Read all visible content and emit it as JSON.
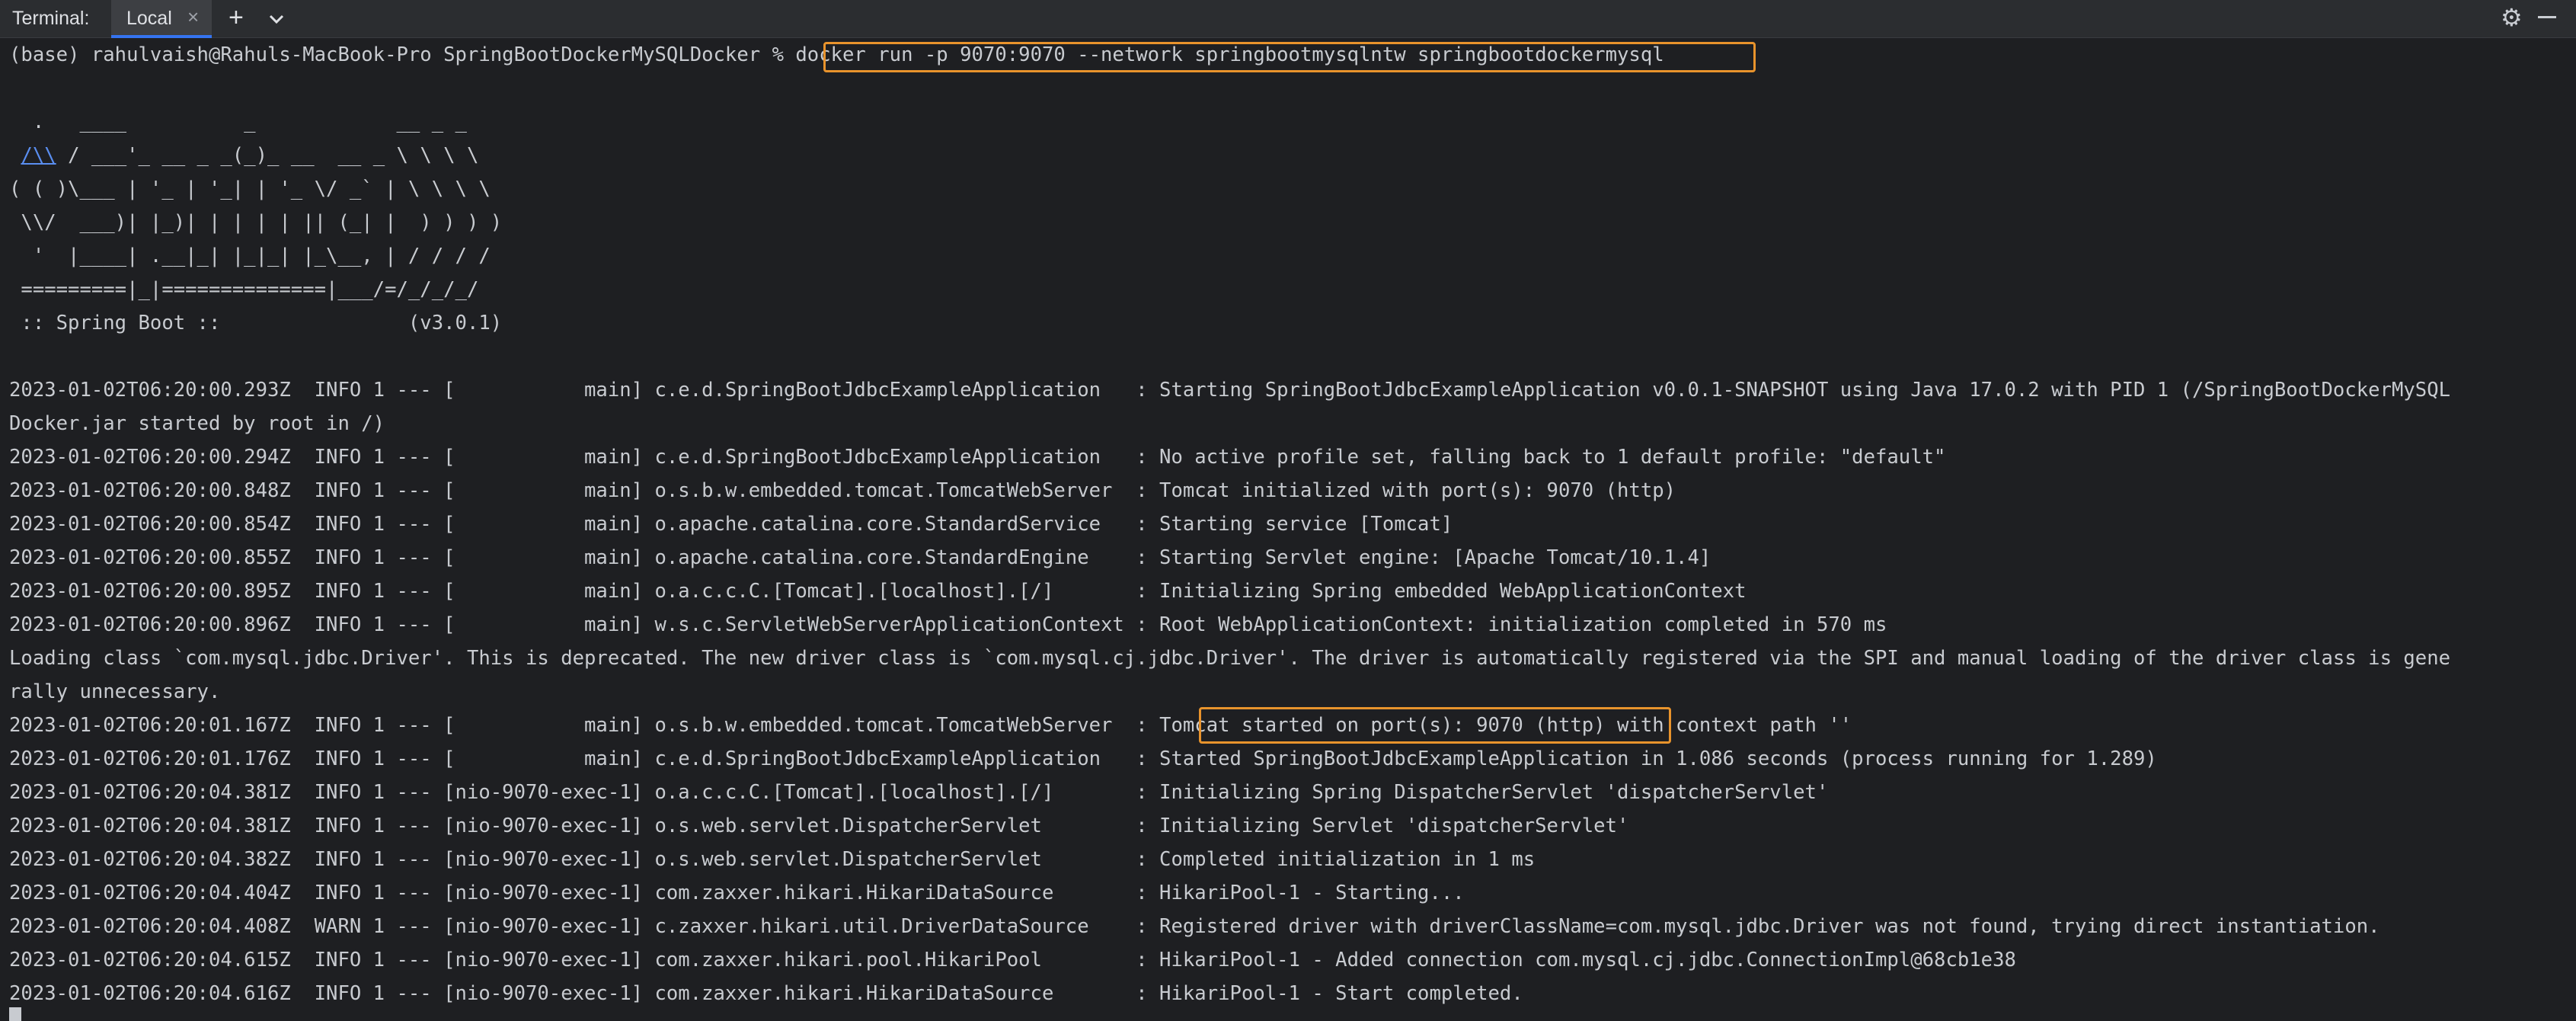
{
  "tabbar": {
    "title": "Terminal:",
    "tab_label": "Local",
    "close_glyph": "×",
    "add_glyph": "+",
    "icons": [
      "close-icon",
      "plus-icon",
      "chevron-down-icon",
      "gear-icon",
      "minimize-icon"
    ]
  },
  "accent": "#e8932c",
  "terminal": {
    "prompt": "(base) rahulvaish@Rahuls-MacBook-Pro SpringBootDockerMySQLDocker % ",
    "command": "docker run -p 9070:9070 --network springbootmysqlntw springbootdockermysql",
    "banner": {
      "l1": "  .   ____          _            __ _ _",
      "l2_link": "/\\\\",
      "l2_rest": " / ___'_ __ _ _(_)_ __  __ _ \\ \\ \\ \\",
      "l3": "( ( )\\___ | '_ | '_| | '_ \\/ _` | \\ \\ \\ \\",
      "l4": " \\\\/  ___)| |_)| | | | | || (_| |  ) ) ) )",
      "l5": "  '  |____| .__|_| |_|_| |_\\__, | / / / /",
      "l6": " =========|_|==============|___/=/_/_/_/",
      "l7": " :: Spring Boot ::                (v3.0.1)"
    },
    "logs": {
      "r1": "2023-01-02T06:20:00.293Z  INFO 1 --- [           main] c.e.d.SpringBootJdbcExampleApplication   : Starting SpringBootJdbcExampleApplication v0.0.1-SNAPSHOT using Java 17.0.2 with PID 1 (/SpringBootDockerMySQL",
      "r1b": "Docker.jar started by root in /)",
      "r2": "2023-01-02T06:20:00.294Z  INFO 1 --- [           main] c.e.d.SpringBootJdbcExampleApplication   : No active profile set, falling back to 1 default profile: \"default\"",
      "r3": "2023-01-02T06:20:00.848Z  INFO 1 --- [           main] o.s.b.w.embedded.tomcat.TomcatWebServer  : Tomcat initialized with port(s): 9070 (http)",
      "r4": "2023-01-02T06:20:00.854Z  INFO 1 --- [           main] o.apache.catalina.core.StandardService   : Starting service [Tomcat]",
      "r5": "2023-01-02T06:20:00.855Z  INFO 1 --- [           main] o.apache.catalina.core.StandardEngine    : Starting Servlet engine: [Apache Tomcat/10.1.4]",
      "r6": "2023-01-02T06:20:00.895Z  INFO 1 --- [           main] o.a.c.c.C.[Tomcat].[localhost].[/]       : Initializing Spring embedded WebApplicationContext",
      "r7": "2023-01-02T06:20:00.896Z  INFO 1 --- [           main] w.s.c.ServletWebServerApplicationContext : Root WebApplicationContext: initialization completed in 570 ms",
      "r8": "Loading class `com.mysql.jdbc.Driver'. This is deprecated. The new driver class is `com.mysql.cj.jdbc.Driver'. The driver is automatically registered via the SPI and manual loading of the driver class is gene",
      "r8b": "rally unnecessary.",
      "r9_prefix": "2023-01-02T06:20:01.167Z  INFO 1 --- [           main] o.s.b.w.embedded.tomcat.TomcatWebServer  : ",
      "r9_highlight": "Tomcat started on port(s): 9070 (http)",
      "r9_suffix": " with context path ''",
      "r10": "2023-01-02T06:20:01.176Z  INFO 1 --- [           main] c.e.d.SpringBootJdbcExampleApplication   : Started SpringBootJdbcExampleApplication in 1.086 seconds (process running for 1.289)",
      "r11": "2023-01-02T06:20:04.381Z  INFO 1 --- [nio-9070-exec-1] o.a.c.c.C.[Tomcat].[localhost].[/]       : Initializing Spring DispatcherServlet 'dispatcherServlet'",
      "r12": "2023-01-02T06:20:04.381Z  INFO 1 --- [nio-9070-exec-1] o.s.web.servlet.DispatcherServlet        : Initializing Servlet 'dispatcherServlet'",
      "r13": "2023-01-02T06:20:04.382Z  INFO 1 --- [nio-9070-exec-1] o.s.web.servlet.DispatcherServlet        : Completed initialization in 1 ms",
      "r14": "2023-01-02T06:20:04.404Z  INFO 1 --- [nio-9070-exec-1] com.zaxxer.hikari.HikariDataSource       : HikariPool-1 - Starting...",
      "r15": "2023-01-02T06:20:04.408Z  WARN 1 --- [nio-9070-exec-1] c.zaxxer.hikari.util.DriverDataSource    : Registered driver with driverClassName=com.mysql.jdbc.Driver was not found, trying direct instantiation.",
      "r16": "2023-01-02T06:20:04.615Z  INFO 1 --- [nio-9070-exec-1] com.zaxxer.hikari.pool.HikariPool        : HikariPool-1 - Added connection com.mysql.cj.jdbc.ConnectionImpl@68cb1e38",
      "r17": "2023-01-02T06:20:04.616Z  INFO 1 --- [nio-9070-exec-1] com.zaxxer.hikari.HikariDataSource       : HikariPool-1 - Start completed."
    }
  }
}
